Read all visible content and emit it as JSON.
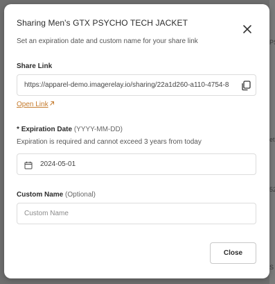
{
  "dialog": {
    "title": "Sharing Men's GTX PSYCHO TECH JACKET",
    "subtitle": "Set an expiration date and custom name for your share link",
    "close_icon": "close-icon"
  },
  "share_link": {
    "label": "Share Link",
    "value": "https://apparel-demo.imagerelay.io/sharing/22a1d260-a110-4754-8",
    "copy_icon": "copy-icon",
    "open_link_label": "Open Link",
    "open_link_icon": "external-link-arrow-icon"
  },
  "expiration": {
    "required_mark": "*",
    "label": "Expiration Date",
    "format_hint": "(YYYY-MM-DD)",
    "help": "Expiration is required and cannot exceed 3 years from today",
    "value": "2024-05-01",
    "icon": "calendar-icon"
  },
  "custom_name": {
    "label": "Custom Name",
    "optional_hint": "(Optional)",
    "placeholder": "Custom Name"
  },
  "footer": {
    "close_label": "Close"
  },
  "background_fragments": [
    "PS",
    "et",
    "52",
    "S"
  ],
  "colors": {
    "link_accent": "#c47a2c",
    "overlay": "#6e6e6e"
  }
}
